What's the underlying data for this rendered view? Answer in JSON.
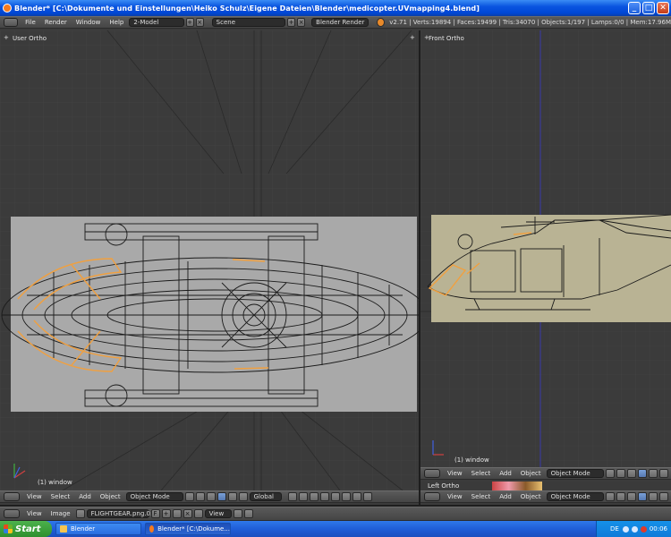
{
  "window": {
    "title": "Blender* [C:\\Dokumente und Einstellungen\\Heiko Schulz\\Eigene Dateien\\Blender\\medicopter.UVmapping4.blend]",
    "minimize": "_",
    "maximize": "□",
    "close": "✕"
  },
  "topbar": {
    "menus": [
      "File",
      "Render",
      "Window",
      "Help"
    ],
    "layout": "2-Model",
    "scene": "Scene",
    "engine": "Blender Render",
    "stats": "v2.71 | Verts:19894 | Faces:19499 | Tris:34070 | Objects:1/197 | Lamps:0/0 | Mem:17.96M"
  },
  "left_viewport": {
    "label": "User Ortho",
    "object_label": "(1) window"
  },
  "right_viewport": {
    "label": "Front Ortho",
    "object_label": "(1) window",
    "side_label": "Left Ortho"
  },
  "left_header": {
    "menus": [
      "View",
      "Select",
      "Add",
      "Object"
    ],
    "mode": "Object Mode",
    "orientation": "Global"
  },
  "right_header": {
    "menus": [
      "View",
      "Select",
      "Add",
      "Object"
    ],
    "mode": "Object Mode"
  },
  "right_header2": {
    "menus": [
      "View",
      "Select",
      "Add",
      "Object"
    ],
    "mode": "Object Mode"
  },
  "uv_header": {
    "menus": [
      "View",
      "Image"
    ],
    "image": "FLIGHTGEAR.png.0...",
    "view_label": "View"
  },
  "taskbar": {
    "start": "Start",
    "items": [
      "Blender",
      "Blender* [C:\\Dokume..."
    ],
    "lang": "DE",
    "clock": "00:06"
  },
  "colors": {
    "mesh_orange": "#f0a040",
    "axis_blue": "#3a3aa8",
    "backdrop_left": "#a9a9a9",
    "backdrop_right": "#b9b394"
  }
}
